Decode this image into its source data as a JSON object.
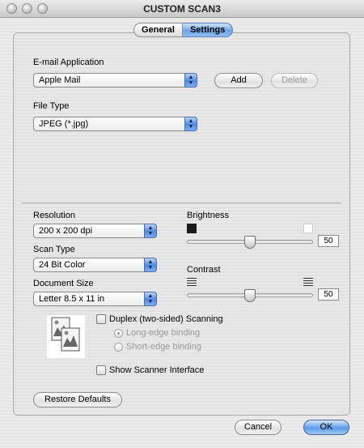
{
  "window": {
    "title": "CUSTOM SCAN3"
  },
  "tabs": [
    {
      "label": "General",
      "active": false
    },
    {
      "label": "Settings",
      "active": true
    }
  ],
  "email": {
    "label": "E-mail Application",
    "value": "Apple Mail",
    "add_label": "Add",
    "delete_label": "Delete"
  },
  "file_type": {
    "label": "File Type",
    "value": "JPEG (*.jpg)"
  },
  "resolution": {
    "label": "Resolution",
    "value": "200 x 200 dpi"
  },
  "scan_type": {
    "label": "Scan Type",
    "value": "24 Bit Color"
  },
  "document_size": {
    "label": "Document Size",
    "value": "Letter  8.5 x 11 in"
  },
  "brightness": {
    "label": "Brightness",
    "value": "50",
    "level_percent": 50
  },
  "contrast": {
    "label": "Contrast",
    "value": "50",
    "level_percent": 50
  },
  "duplex": {
    "label": "Duplex (two-sided) Scanning",
    "checked": false,
    "long_edge_label": "Long-edge binding",
    "short_edge_label": "Short-edge binding"
  },
  "show_scanner_interface": {
    "label": "Show Scanner Interface",
    "checked": false
  },
  "buttons": {
    "restore_defaults": "Restore Defaults",
    "cancel": "Cancel",
    "ok": "OK"
  },
  "colors": {
    "accent": "#6fa5e8",
    "panel": "#e8e8e8"
  }
}
